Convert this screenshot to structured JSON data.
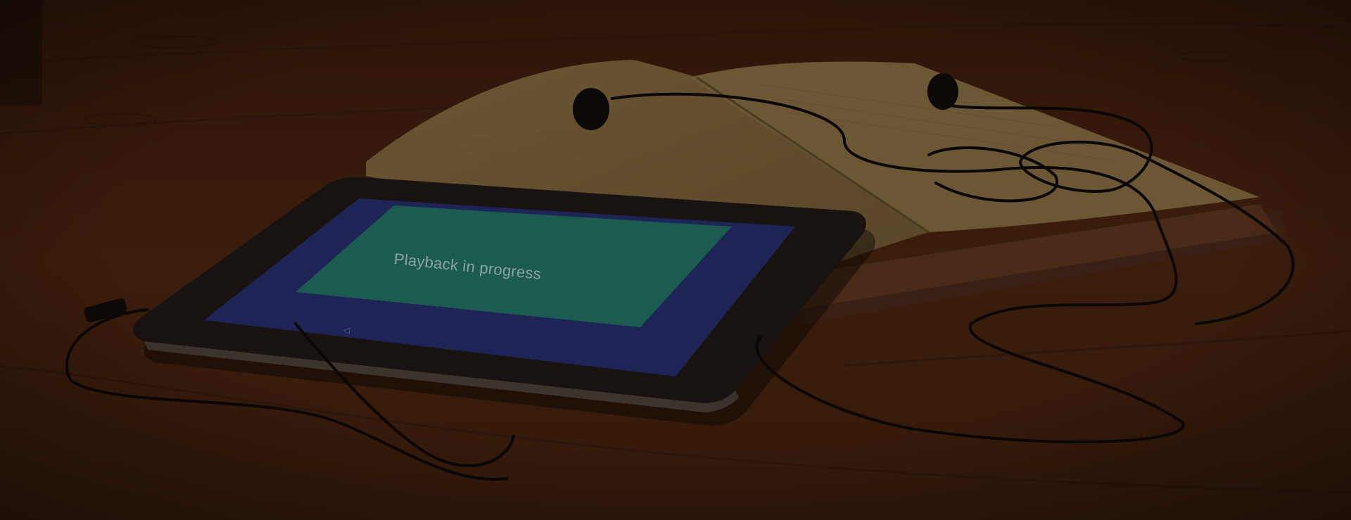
{
  "photo": {
    "screen_message": "Playback in progress",
    "nav_back_glyph": "◁"
  },
  "colors": {
    "table": "#3a1d0d",
    "tablet_frame": "#181210",
    "screen_border": "#1e2456",
    "screen_panel": "#1c5c50",
    "book_page": "#6e5a36",
    "cable": "#0b0705"
  }
}
